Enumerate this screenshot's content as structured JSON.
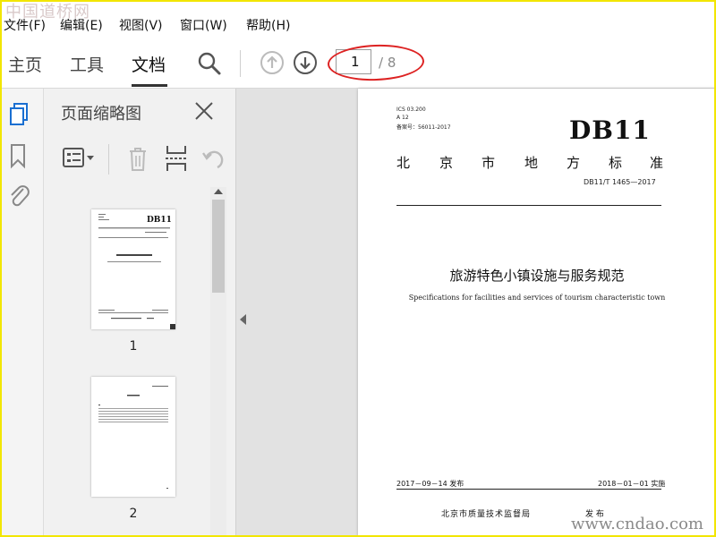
{
  "watermarks": {
    "top_left": "中国道桥网",
    "bottom_right": "www.cndao.com"
  },
  "menu": [
    "文件(F)",
    "编辑(E)",
    "视图(V)",
    "窗口(W)",
    "帮助(H)"
  ],
  "toolbar": {
    "tabs": [
      "主页",
      "工具",
      "文档"
    ],
    "active_tab": "文档",
    "icons": [
      "search-icon",
      "prev-page-icon",
      "next-page-icon"
    ],
    "page_current": "1",
    "page_total": "/ 8"
  },
  "left_rail": {
    "icons": [
      "pages-icon",
      "bookmark-icon",
      "attachment-icon"
    ]
  },
  "thumb_panel": {
    "title": "页面缩略图",
    "tools": [
      "options-icon",
      "delete-icon",
      "insert-icon",
      "undo-icon"
    ],
    "thumbnails": [
      {
        "label": "1"
      },
      {
        "label": "2"
      }
    ]
  },
  "document": {
    "ics": "ICS  03.200",
    "a12": "A 12",
    "record": "备案号：56011-2017",
    "code": "DB11",
    "region_chars": [
      "北",
      "京",
      "市",
      "地",
      "方",
      "标",
      "准"
    ],
    "standard_no": "DB11/T 1465—2017",
    "title_cn": "旅游特色小镇设施与服务规范",
    "title_en": "Specifications for facilities and services of tourism characteristic town",
    "issue_date": "2017－09－14 发布",
    "implement_date": "2018－01－01 实施",
    "issuer": "北京市质量技术监督局",
    "issuer_suffix": "发 布"
  },
  "colors": {
    "frame": "#f2e600",
    "annotation_oval": "#dd2222",
    "panel_bg": "#f1f1f1",
    "doc_bg": "#e2e2e2"
  }
}
